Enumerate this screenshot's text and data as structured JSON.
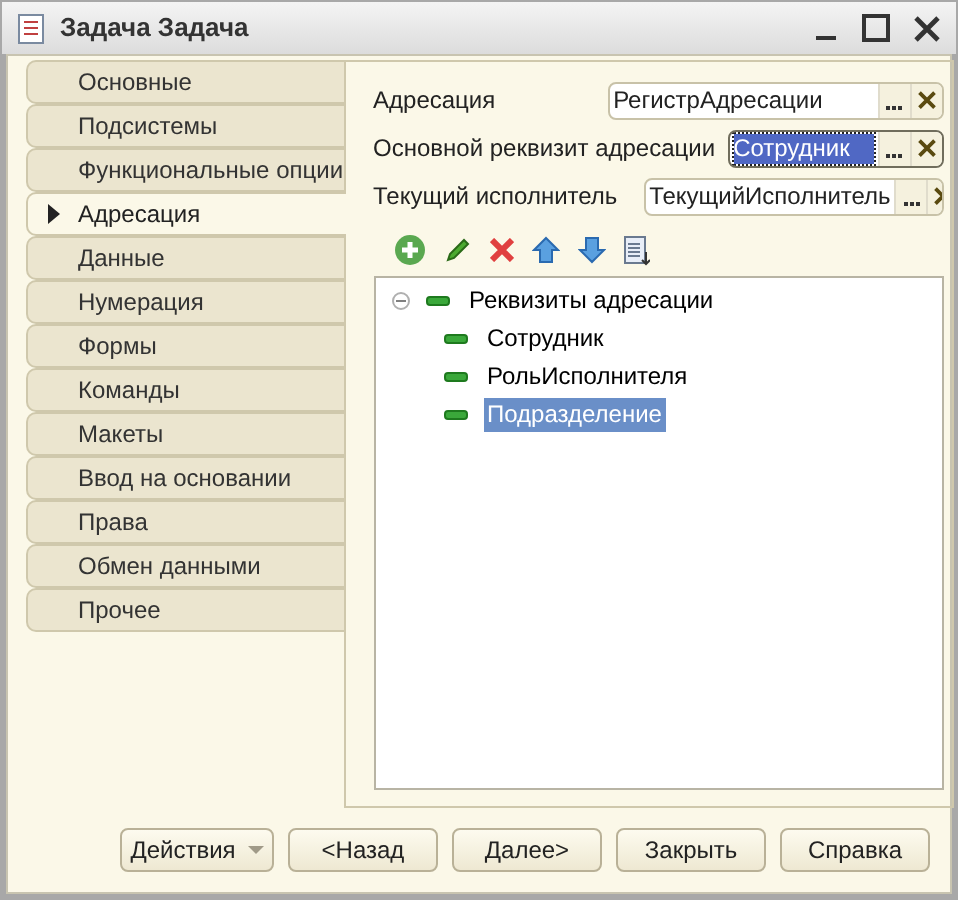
{
  "window": {
    "title": "Задача Задача"
  },
  "tabs": [
    {
      "label": "Основные",
      "selected": false
    },
    {
      "label": "Подсистемы",
      "selected": false
    },
    {
      "label": "Функциональные опции",
      "selected": false
    },
    {
      "label": "Адресация",
      "selected": true
    },
    {
      "label": "Данные",
      "selected": false
    },
    {
      "label": "Нумерация",
      "selected": false
    },
    {
      "label": "Формы",
      "selected": false
    },
    {
      "label": "Команды",
      "selected": false
    },
    {
      "label": "Макеты",
      "selected": false
    },
    {
      "label": "Ввод на основании",
      "selected": false
    },
    {
      "label": "Права",
      "selected": false
    },
    {
      "label": "Обмен данными",
      "selected": false
    },
    {
      "label": "Прочее",
      "selected": false
    }
  ],
  "fields": [
    {
      "label": "Адресация",
      "value": "РегистрАдресации",
      "focused": false
    },
    {
      "label": "Основной реквизит адресации",
      "value": "Сотрудник",
      "focused": true
    },
    {
      "label": "Текущий исполнитель",
      "value": "ТекущийИсполнитель",
      "focused": false
    }
  ],
  "tree": [
    {
      "label": "Реквизиты адресации",
      "expanded": true,
      "selected": false,
      "children": [
        {
          "label": "Сотрудник",
          "selected": false
        },
        {
          "label": "РольИсполнителя",
          "selected": false
        },
        {
          "label": "Подразделение",
          "selected": true
        }
      ]
    }
  ],
  "buttons": [
    {
      "label": "Действия",
      "kind": "menu"
    },
    {
      "label": "<Назад",
      "kind": "plain"
    },
    {
      "label": "Далее>",
      "kind": "plain"
    },
    {
      "label": "Закрыть",
      "kind": "plain"
    },
    {
      "label": "Справка",
      "kind": "plain"
    }
  ]
}
